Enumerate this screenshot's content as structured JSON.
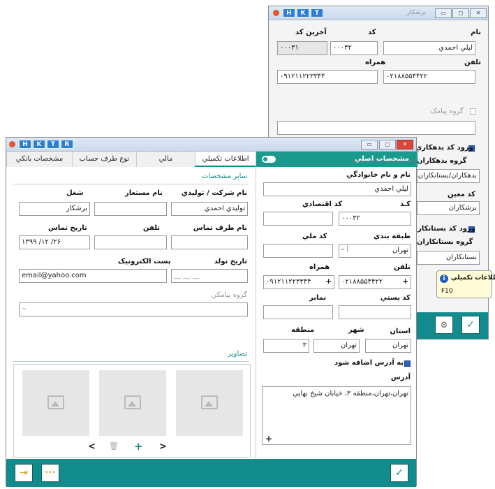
{
  "back_win": {
    "badges": [
      "H",
      "K",
      "T"
    ],
    "title": "برشکار",
    "labels": {
      "name": "نام",
      "code": "کد",
      "last_code": "آخرين کد",
      "phone": "تلفن",
      "mobile": "همراه",
      "sms_group": "گروه پيامک",
      "debtor_code_entry": "ورود کد بدهکاري",
      "debtor_group": "گروه بدهکاران",
      "moein_code": "کد معين",
      "creditor_code_entry": "ورود کد بستانکاري",
      "creditor_group": "گروه بستانکاران"
    },
    "values": {
      "name": "ليلي احمدي",
      "code": "۰۰۰۳۲",
      "last_code": "۰۰۰۳۱",
      "phone": "۰۲۱۸۸۵۵۴۴۲۲",
      "mobile": "۰۹۱۲۱۱۲۲۳۳۴۴",
      "debtor_group": "بدهکاران/بستانکاران",
      "moein": "برشکاران",
      "creditor_group": "بستانکاران"
    },
    "tooltip": {
      "title": "اطلاعات تکميلي",
      "key": "F10"
    }
  },
  "front_win": {
    "badges": [
      "H",
      "K",
      "T",
      "R"
    ],
    "tabs": {
      "main": "مشخصات اصلي",
      "extra": "اطلاعات تکميلي",
      "financial": "مالي",
      "account_type": "نوع طرف حساب",
      "bank": "مشخصات بانکي"
    },
    "main": {
      "labels": {
        "fullname": "نام و نام خانوادگي",
        "code": "کـد",
        "economic_code": "کد اقتصادي",
        "category": "طبقه بندي",
        "national_code": "کد ملي",
        "phone": "تلفن",
        "mobile": "همراه",
        "postal_code": "کد پستي",
        "fax": "نمابر",
        "province": "استان",
        "city": "شهر",
        "region": "منطقه",
        "add_to_address": "به آدرس اضافه شود",
        "address": "آدرس"
      },
      "values": {
        "fullname": "ليلي احمدي",
        "code": "۰۰۰۳۲",
        "category": "تهران",
        "phone": "۰۲۱۸۸۵۵۴۴۲۲",
        "mobile": "۰۹۱۲۱۱۲۲۳۳۴۴",
        "province": "تهران",
        "city": "تهران",
        "region": "۳",
        "address": "تهران،تهران،منطقه ۳، خيابان شيخ بهايي"
      },
      "plus": "+"
    },
    "extra": {
      "section_other": "ساير مشخصات",
      "labels": {
        "company": "نام شرکت / توليدي",
        "alias": "نام مستعار",
        "job": "شغل",
        "contact_name": "نام طرف تماس",
        "contact_phone": "تلفن",
        "contact_date": "تاريخ تماس",
        "birth_date": "تاريخ تولد",
        "email": "پست الکترونيک",
        "sms_group": "گروه پيامکي"
      },
      "values": {
        "company": "توليدي احمدي",
        "job": "برشکار",
        "contact_date": "۱۳۹۹   /۱۲  /۲۶",
        "birth_date": "__.__.__",
        "email": "email@yahoo.com"
      },
      "section_images": "تصاوير",
      "img_nav": {
        "prev": "<",
        "delete": "🗑",
        "add": "+",
        "next": ">"
      }
    },
    "footer": {
      "exit": "⇥",
      "more": "•••",
      "ok": "✓"
    }
  }
}
